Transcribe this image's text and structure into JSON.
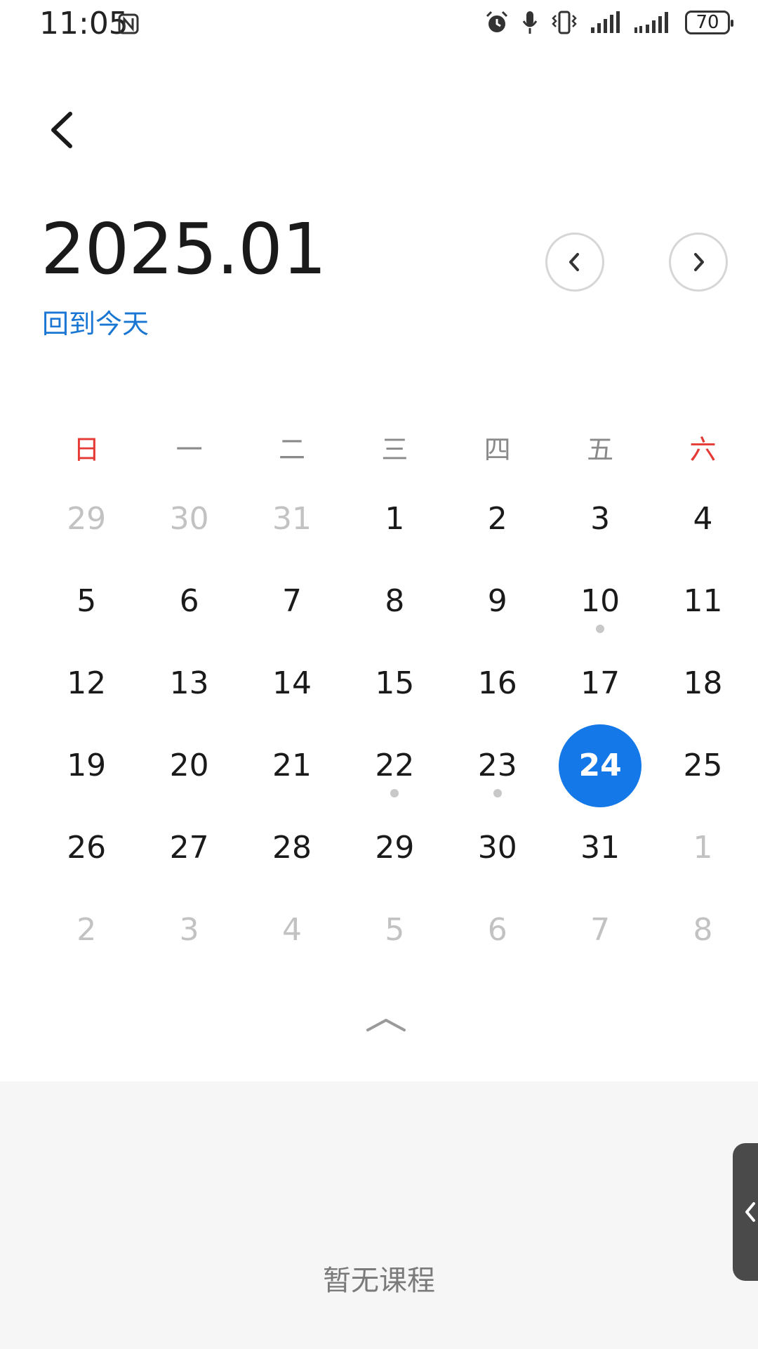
{
  "status_bar": {
    "time": "11:05",
    "battery": "70",
    "icons": [
      "nfc-icon",
      "alarm-icon",
      "mic-icon",
      "vibrate-icon",
      "signal-icon",
      "signal-icon"
    ]
  },
  "header": {
    "month_title": "2025.01",
    "today_link": "回到今天"
  },
  "calendar": {
    "weekdays": [
      "日",
      "一",
      "二",
      "三",
      "四",
      "五",
      "六"
    ],
    "weeks": [
      [
        "29",
        "30",
        "31",
        "1",
        "2",
        "3",
        "4"
      ],
      [
        "5",
        "6",
        "7",
        "8",
        "9",
        "10",
        "11"
      ],
      [
        "12",
        "13",
        "14",
        "15",
        "16",
        "17",
        "18"
      ],
      [
        "19",
        "20",
        "21",
        "22",
        "23",
        "24",
        "25"
      ],
      [
        "26",
        "27",
        "28",
        "29",
        "30",
        "31",
        "1"
      ],
      [
        "2",
        "3",
        "4",
        "5",
        "6",
        "7",
        "8"
      ]
    ],
    "selected_day": "24",
    "days_with_events": [
      "10",
      "22",
      "23"
    ],
    "colors": {
      "accent": "#1478e8",
      "weekend": "#e53935",
      "muted": "#c2c2c2"
    }
  },
  "schedule": {
    "empty_text": "暂无课程"
  }
}
